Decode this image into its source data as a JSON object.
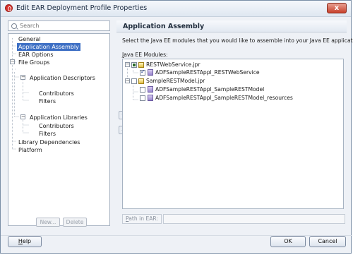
{
  "window": {
    "title": "Edit EAR Deployment Profile Properties",
    "close_glyph": "x",
    "app_icon": "oracle-jdeveloper-icon"
  },
  "search": {
    "placeholder": "Search"
  },
  "nav_tree": [
    {
      "label": "General",
      "level": 0,
      "selected": false
    },
    {
      "label": "Application Assembly",
      "level": 0,
      "selected": true
    },
    {
      "label": "EAR Options",
      "level": 0,
      "selected": false
    },
    {
      "label": "File Groups",
      "level": 0,
      "expanded": true,
      "selected": false
    },
    {
      "label": "Application Descriptors",
      "level": 1,
      "expanded": true,
      "selected": false
    },
    {
      "label": "Contributors",
      "level": 2,
      "selected": false
    },
    {
      "label": "Filters",
      "level": 2,
      "selected": false
    },
    {
      "label": "Application Libraries",
      "level": 1,
      "expanded": true,
      "selected": false
    },
    {
      "label": "Contributors",
      "level": 2,
      "selected": false
    },
    {
      "label": "Filters",
      "level": 2,
      "selected": false
    },
    {
      "label": "Library Dependencies",
      "level": 0,
      "selected": false
    },
    {
      "label": "Platform",
      "level": 0,
      "selected": false
    }
  ],
  "nav_buttons": {
    "new": "New...",
    "delete": "Delete"
  },
  "panel": {
    "title": "Application Assembly",
    "description": "Select the Java EE modules that you would like to assemble into your Java EE application.",
    "modules_label_prefix": "J",
    "modules_label_rest": "ava EE Modules:"
  },
  "modules": [
    {
      "project": "RESTWebService.jpr",
      "check": "partial",
      "children": [
        {
          "label": "ADFSampleRESTAppl_RESTWebService",
          "checked": true
        }
      ]
    },
    {
      "project": "SampleRESTModel.jpr",
      "check": "none",
      "children": [
        {
          "label": "ADFSampleRESTAppl_SampleRESTModel",
          "checked": false
        },
        {
          "label": "ADFSampleRESTAppl_SampleRESTModel_resources",
          "checked": false
        }
      ]
    }
  ],
  "path_in_ear": {
    "prefix": "P",
    "rest": "ath in EAR:",
    "value": ""
  },
  "move": {
    "up": "⌃",
    "down": "⌄"
  },
  "footer": {
    "help_prefix": "H",
    "help_rest": "elp",
    "ok": "OK",
    "cancel": "Cancel"
  }
}
